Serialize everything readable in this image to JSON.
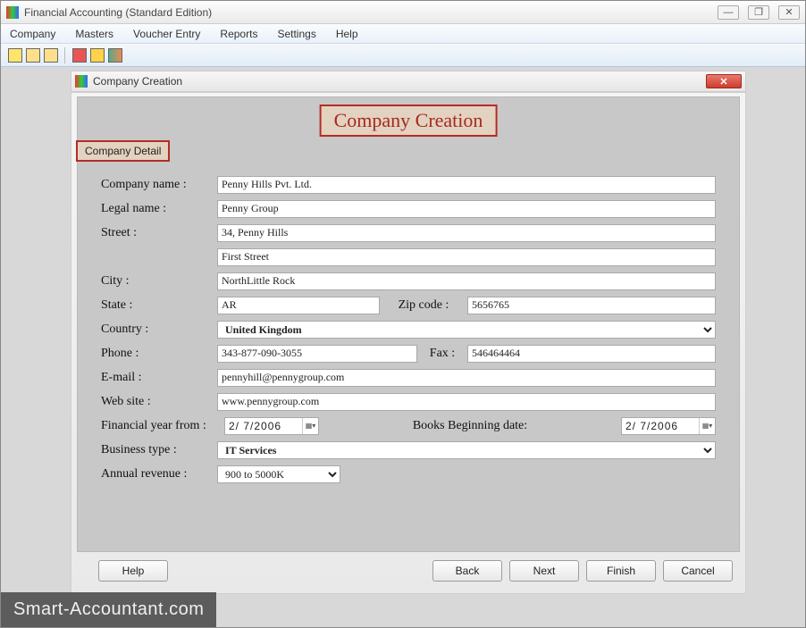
{
  "app": {
    "title": "Financial Accounting (Standard Edition)"
  },
  "menu": {
    "items": [
      "Company",
      "Masters",
      "Voucher Entry",
      "Reports",
      "Settings",
      "Help"
    ]
  },
  "dialog": {
    "title": "Company Creation",
    "heading": "Company Creation",
    "tab": "Company Detail"
  },
  "labels": {
    "company_name": "Company name :",
    "legal_name": "Legal name :",
    "street": "Street :",
    "city": "City :",
    "state": "State :",
    "zip": "Zip code :",
    "country": "Country :",
    "phone": "Phone :",
    "fax": "Fax :",
    "email": "E-mail :",
    "website": "Web site :",
    "fin_year": "Financial year from :",
    "books_begin": "Books Beginning date:",
    "business_type": "Business type :",
    "annual_revenue": "Annual revenue :"
  },
  "values": {
    "company_name": "Penny Hills Pvt. Ltd.",
    "legal_name": "Penny Group",
    "street1": "34, Penny Hills",
    "street2": "First Street",
    "city": "NorthLittle Rock",
    "state": "AR",
    "zip": "5656765",
    "country": "United Kingdom",
    "phone": "343-877-090-3055",
    "fax": "546464464",
    "email": "pennyhill@pennygroup.com",
    "website": "www.pennygroup.com",
    "fin_year": "2/  7/2006",
    "books_begin": "2/  7/2006",
    "business_type": "IT Services",
    "annual_revenue": "900 to 5000K"
  },
  "buttons": {
    "help": "Help",
    "back": "Back",
    "next": "Next",
    "finish": "Finish",
    "cancel": "Cancel"
  },
  "watermark": "Smart-Accountant.com"
}
